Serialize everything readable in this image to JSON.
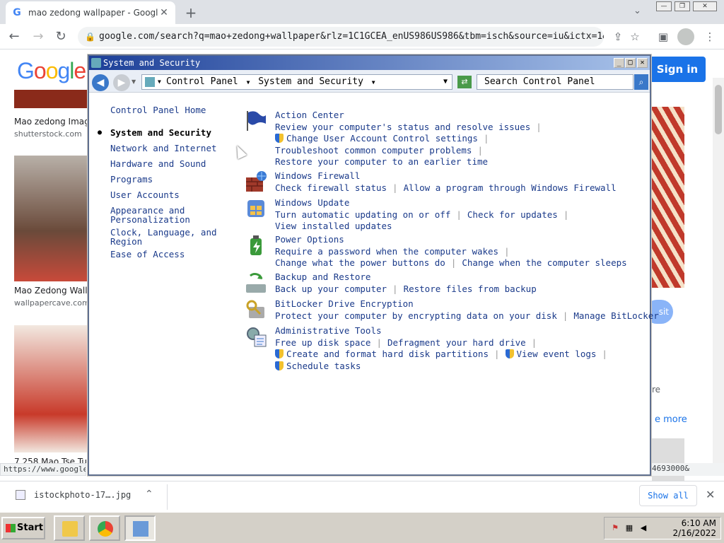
{
  "browser": {
    "tab_title": "mao zedong wallpaper - Google",
    "address": "google.com/search?q=mao+zedong+wallpaper&rlz=1C1GCEA_enUS986US986&tbm=isch&source=iu&ictx=1&vet=1&…",
    "status_url": "https://www.google",
    "status_url_right": "4693000&"
  },
  "google": {
    "logo": "Google",
    "signin": "Sign in",
    "results": [
      {
        "caption": "Mao zedong Imag",
        "source": "shutterstock.com"
      },
      {
        "caption": "Mao Zedong Wall",
        "source": "wallpapercave.com"
      },
      {
        "caption": "7,258 Mao Tse Tu",
        "source": ""
      }
    ],
    "right_visit": "sit",
    "right_more": "e more",
    "right_re": "re"
  },
  "downloads": {
    "file": "istockphoto-17….jpg",
    "show_all": "Show all"
  },
  "control_panel": {
    "title": "System and Security",
    "breadcrumb": [
      "Control Panel",
      "System and Security"
    ],
    "search_placeholder": "Search Control Panel",
    "nav": [
      {
        "label": "Control Panel Home"
      },
      {
        "label": "System and Security",
        "selected": true
      },
      {
        "label": "Network and Internet"
      },
      {
        "label": "Hardware and Sound"
      },
      {
        "label": "Programs"
      },
      {
        "label": "User Accounts"
      },
      {
        "label": "Appearance and\nPersonalization"
      },
      {
        "label": "Clock, Language, and\nRegion"
      },
      {
        "label": "Ease of Access"
      }
    ],
    "categories": {
      "action_center": {
        "title": "Action Center",
        "l1": "Review your computer's status and resolve issues",
        "l2": "Change User Account Control settings",
        "l3": "Troubleshoot common computer problems",
        "l4": "Restore your computer to an earlier time"
      },
      "firewall": {
        "title": "Windows Firewall",
        "a": "Check firewall status",
        "b": "Allow a program through Windows Firewall"
      },
      "update": {
        "title": "Windows Update",
        "a": "Turn automatic updating on or off",
        "b": "Check for updates",
        "c": "View installed updates"
      },
      "power": {
        "title": "Power Options",
        "a": "Require a password when the computer wakes",
        "b": "Change what the power buttons do",
        "c": "Change when the computer sleeps"
      },
      "backup": {
        "title": "Backup and Restore",
        "a": "Back up your computer",
        "b": "Restore files from backup"
      },
      "bitlocker": {
        "title": "BitLocker Drive Encryption",
        "a": "Protect your computer by encrypting data on your disk",
        "b": "Manage BitLocker"
      },
      "admin": {
        "title": "Administrative Tools",
        "a": "Free up disk space",
        "b": "Defragment your hard drive",
        "c": "Create and format hard disk partitions",
        "d": "View event logs",
        "e": "Schedule tasks"
      }
    }
  },
  "taskbar": {
    "start": "Start",
    "time": "6:10 AM",
    "date": "2/16/2022"
  }
}
